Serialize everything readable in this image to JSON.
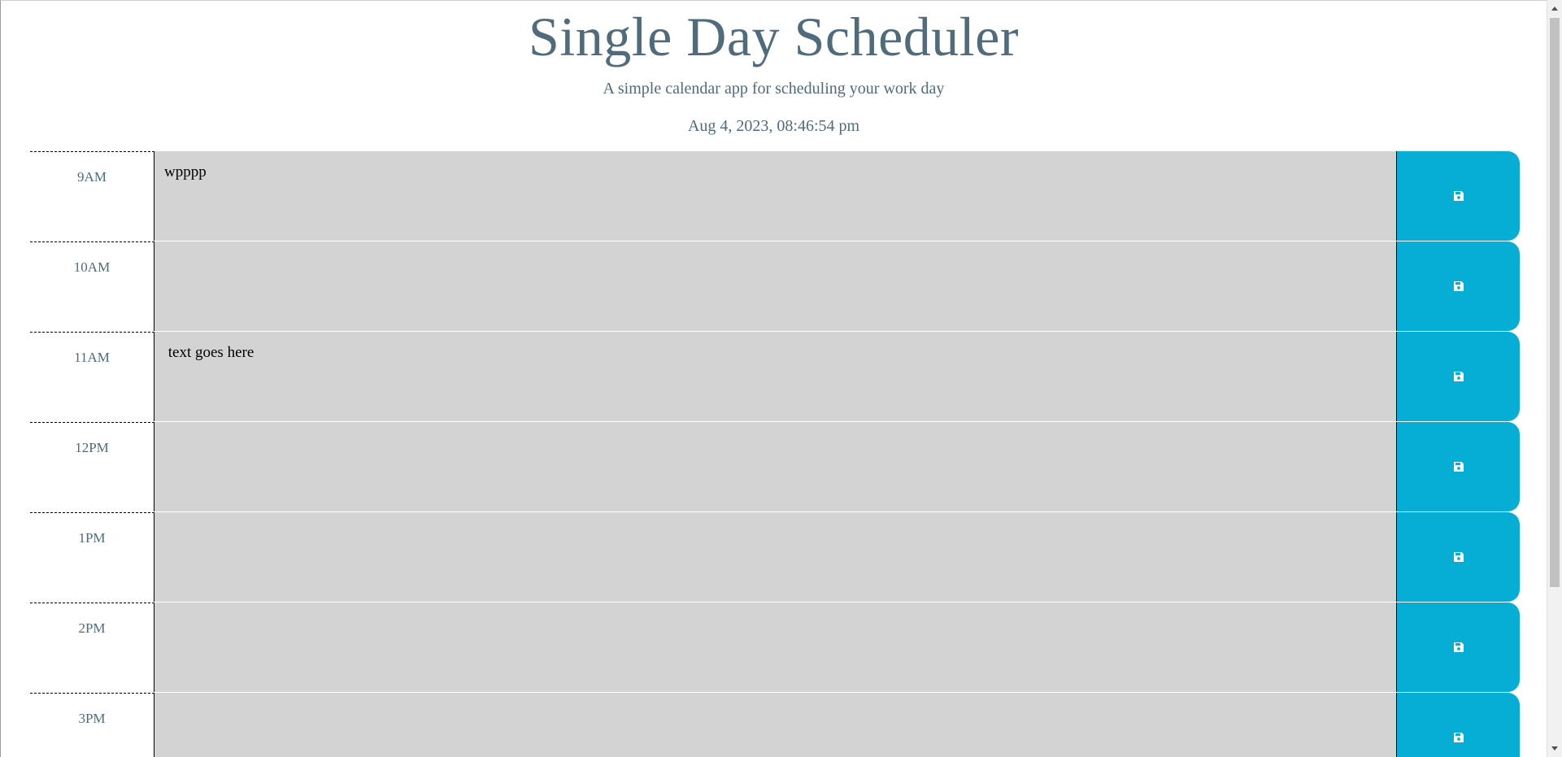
{
  "header": {
    "title": "Single Day Scheduler",
    "subtitle": "A simple calendar app for scheduling your work day",
    "datetime": "Aug 4, 2023, 08:46:54 pm"
  },
  "colors": {
    "accent": "#06aed5",
    "row_background": "#d3d3d3",
    "header_text": "#4f6b7c"
  },
  "rows": [
    {
      "hour": "9AM",
      "text": "wpppp",
      "save_icon": "save-icon"
    },
    {
      "hour": "10AM",
      "text": "",
      "save_icon": "save-icon"
    },
    {
      "hour": "11AM",
      "text": " text goes here",
      "save_icon": "save-icon"
    },
    {
      "hour": "12PM",
      "text": "",
      "save_icon": "save-icon"
    },
    {
      "hour": "1PM",
      "text": "",
      "save_icon": "save-icon"
    },
    {
      "hour": "2PM",
      "text": "",
      "save_icon": "save-icon"
    },
    {
      "hour": "3PM",
      "text": "",
      "save_icon": "save-icon"
    }
  ]
}
